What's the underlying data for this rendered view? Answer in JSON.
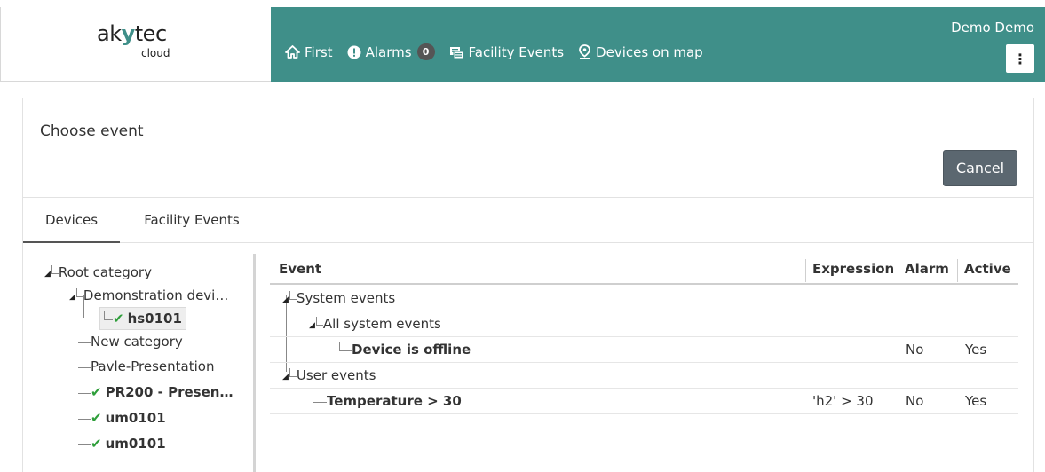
{
  "header": {
    "logo_text_left": "ak",
    "logo_text_mid": "y",
    "logo_text_right": "tec",
    "logo_sub": "cloud",
    "nav": [
      {
        "label": "First",
        "icon": "home-icon"
      },
      {
        "label": "Alarms",
        "icon": "alert-circle-icon",
        "badge": "0"
      },
      {
        "label": "Facility Events",
        "icon": "facility-events-icon"
      },
      {
        "label": "Devices on map",
        "icon": "map-marker-icon"
      }
    ],
    "user_name": "Demo Demo",
    "menu_glyph": "⋮",
    "accent_color": "#3f8f89"
  },
  "panel": {
    "title": "Choose event",
    "cancel_label": "Cancel",
    "tabs": [
      {
        "label": "Devices",
        "active": true
      },
      {
        "label": "Facility Events",
        "active": false
      }
    ]
  },
  "tree": {
    "root": "Root category",
    "items": [
      {
        "label": "Demonstration devi…"
      },
      {
        "label": "hs0101",
        "check": "✔"
      },
      {
        "label": "New category"
      },
      {
        "label": "Pavle-Presentation"
      },
      {
        "label": "PR200 - Presen…",
        "check": "✔"
      },
      {
        "label": "um0101",
        "check": "✔"
      },
      {
        "label": "um0101",
        "check": "✔"
      }
    ]
  },
  "events": {
    "columns": [
      "Event",
      "Expression",
      "Alarm",
      "Active"
    ],
    "rows": [
      {
        "event": "System events",
        "expression": "",
        "alarm": "",
        "active": ""
      },
      {
        "event": "All system events",
        "expression": "",
        "alarm": "",
        "active": ""
      },
      {
        "event": "Device is offline",
        "expression": "",
        "alarm": "No",
        "active": "Yes"
      },
      {
        "event": "User events",
        "expression": "",
        "alarm": "",
        "active": ""
      },
      {
        "event": "Temperature > 30",
        "expression": "'h2' > 30",
        "alarm": "No",
        "active": "Yes"
      }
    ]
  }
}
